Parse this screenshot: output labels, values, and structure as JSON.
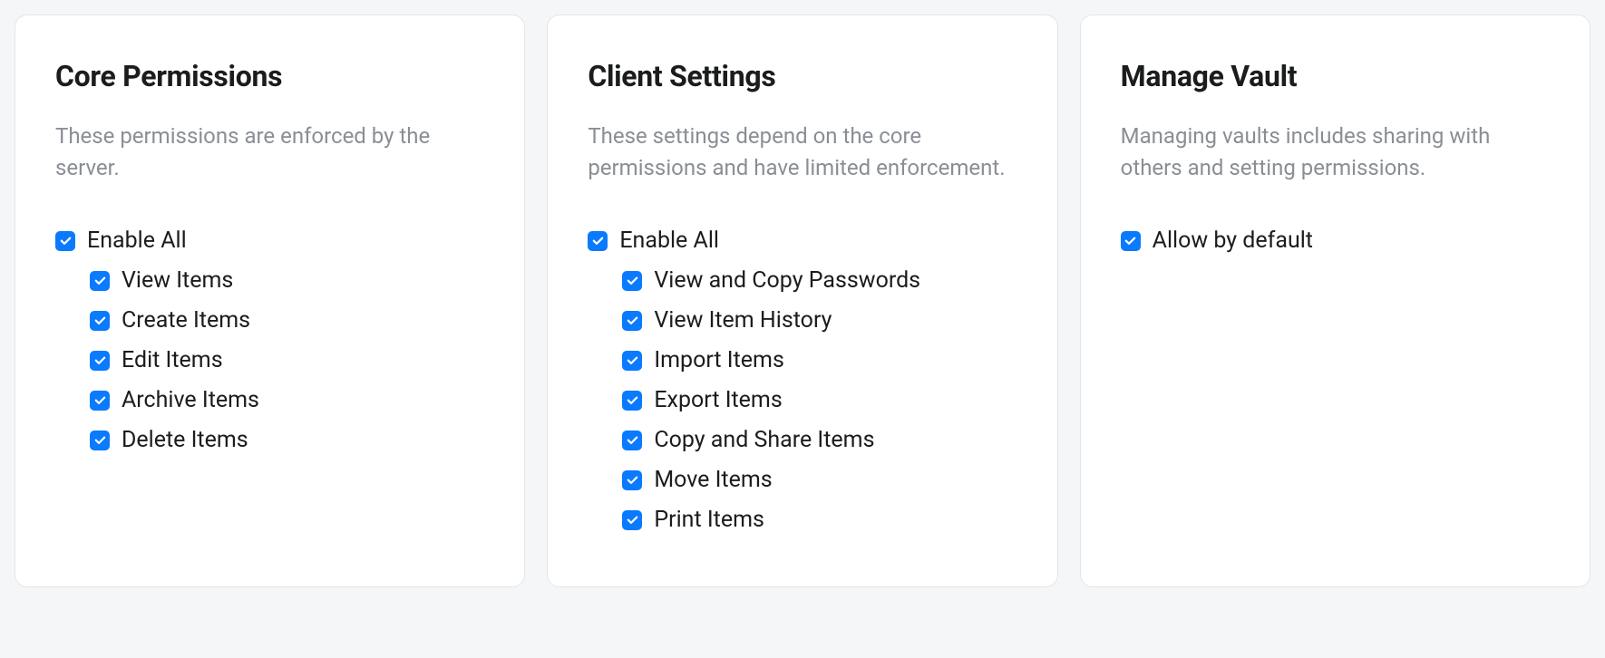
{
  "cards": [
    {
      "key": "core",
      "title": "Core Permissions",
      "description": "These permissions are enforced by the server.",
      "enable_all_label": "Enable All",
      "options": [
        {
          "label": "View Items",
          "checked": true
        },
        {
          "label": "Create Items",
          "checked": true
        },
        {
          "label": "Edit Items",
          "checked": true
        },
        {
          "label": "Archive Items",
          "checked": true
        },
        {
          "label": "Delete Items",
          "checked": true
        }
      ]
    },
    {
      "key": "client",
      "title": "Client Settings",
      "description": "These settings depend on the core permissions and have limited enforcement.",
      "enable_all_label": "Enable All",
      "options": [
        {
          "label": "View and Copy Passwords",
          "checked": true
        },
        {
          "label": "View Item History",
          "checked": true
        },
        {
          "label": "Import Items",
          "checked": true
        },
        {
          "label": "Export Items",
          "checked": true
        },
        {
          "label": "Copy and Share Items",
          "checked": true
        },
        {
          "label": "Move Items",
          "checked": true
        },
        {
          "label": "Print Items",
          "checked": true
        }
      ]
    },
    {
      "key": "vault",
      "title": "Manage Vault",
      "description": "Managing vaults includes sharing with others and setting permissions.",
      "allow_label": "Allow by default",
      "allow_checked": true
    }
  ]
}
